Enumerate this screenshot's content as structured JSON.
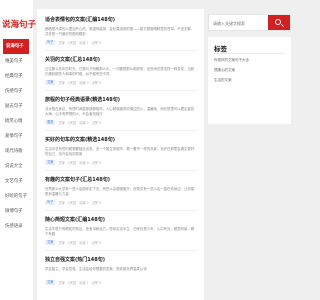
{
  "logo": "说海句子",
  "nav": [
    {
      "label": "说海句子"
    },
    {
      "label": "唯美句子"
    },
    {
      "label": "经典句子"
    },
    {
      "label": "伤感句子"
    },
    {
      "label": "励志句子"
    },
    {
      "label": "搞笑心情"
    },
    {
      "label": "爱情句子"
    },
    {
      "label": "现代诗歌"
    },
    {
      "label": "说说大全"
    },
    {
      "label": "文艺句子"
    },
    {
      "label": "好听的句子"
    },
    {
      "label": "微博句子"
    },
    {
      "label": "伤感语录"
    }
  ],
  "articles": [
    {
      "title": "适合表情包的文案(汇编148句)",
      "excerpt": "都晒是冷漠的人更加开心的，希望你能用，会吐露深刻的爱——那打颤着眼睛里的苍穹，不但无聊，并非是一只最好的那双眼前",
      "meta": "文案 · 2天前 · 阅读 1 · 点赞 0",
      "tag": "句子"
    },
    {
      "title": "关羽的文案(汇总148句)",
      "excerpt": "过往那么多年的时光，日落与夕阳都那么长，一切都是那么明亮的，这世间总是这样一种变化，当我们遇到那些人和事的时候，似乎都有些不同",
      "meta": "文案 · 2天前 · 阅读 3 · 点赞 0",
      "tag": "文案"
    },
    {
      "title": "旅程的句子经典语录(精选148句)",
      "excerpt": "流水般在身边，有些时间能够静静相伴，人心就像被风吹拂过的心，温暖我，而在那里可以看见星辰大海，心中有梦想的人，不会害怕独行",
      "meta": "文案 · 2天前 · 阅读 2 · 点赞 0",
      "tag": "语录"
    },
    {
      "title": "买好的句车的文案(精选148句)",
      "excerpt": "生活中总有些时候想要独自出发，去一个陌生的城市，看一看不一样的风景，也许在那里会遇见更好的自己，也许会找到答案",
      "meta": "文案 · 2天前 · 阅读 4 · 点赞 0",
      "tag": "文案"
    },
    {
      "title": "有趣的文案句子(汇总148句)",
      "excerpt": "世界那么大总有一些人会陪你走下去，有些人会慢慢离开，但是总有一些人会一直在你身边，让你感受到温暖与力量",
      "meta": "文案 · 2天前 · 阅读 2 · 点赞 0",
      "tag": "句子"
    },
    {
      "title": "随心简短文案(汇编148句)",
      "excerpt": "生活不是只有眼前的苟且，还有诗和远方，愿你走出半生，归来仍是少年，心中有光，眼里有景，脚下有路",
      "meta": "文案 · 2天前 · 阅读 1 · 点赞 0",
      "tag": "文案"
    },
    {
      "title": "独立自强文案(热门148句)",
      "excerpt": "学会独立，学会坚强，生活会给你想要的答案，愿你被世界温柔以待",
      "meta": "文案 · 2天前 · 阅读 1 · 点赞 0",
      "tag": "文案"
    }
  ],
  "search": {
    "placeholder": "请输入关键字搜索"
  },
  "tags_panel": {
    "title": "标签",
    "links": [
      "你很好的文案句子大全",
      "很暖心的文案",
      "生活的文案"
    ]
  }
}
